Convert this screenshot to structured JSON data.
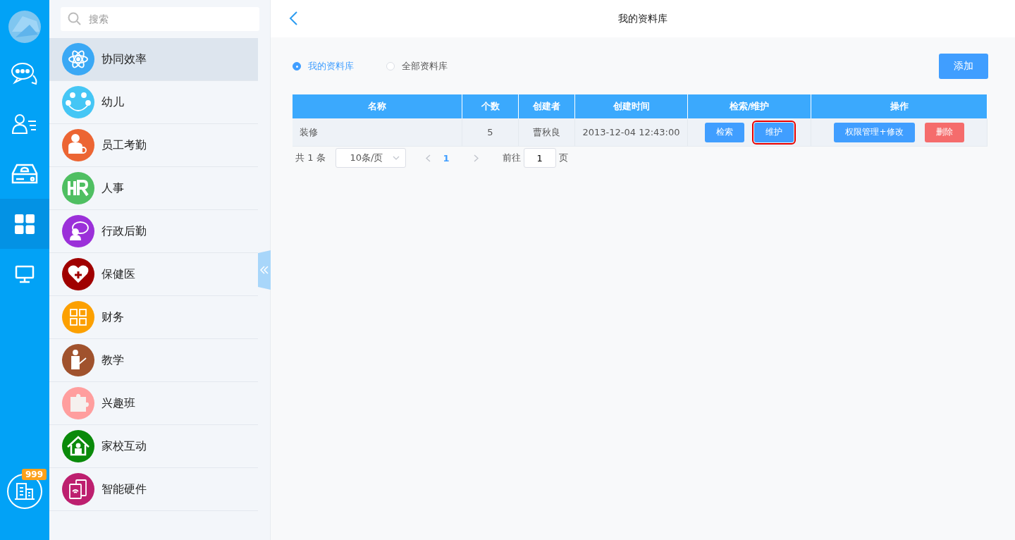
{
  "nav_rail": {
    "items": [
      {
        "selected": false
      },
      {
        "selected": false
      },
      {
        "selected": false
      },
      {
        "selected": true
      },
      {
        "selected": false
      }
    ],
    "badge": "999"
  },
  "sidebar": {
    "search": {
      "placeholder": "搜索"
    },
    "items": [
      {
        "label": "协同效率",
        "color": "#3aa8f5",
        "selected": true
      },
      {
        "label": "幼儿",
        "color": "#45c6f5",
        "selected": false
      },
      {
        "label": "员工考勤",
        "color": "#ec6533",
        "selected": false
      },
      {
        "label": "人事",
        "color": "#4fbf62",
        "selected": false
      },
      {
        "label": "行政后勤",
        "color": "#9b30d9",
        "selected": false
      },
      {
        "label": "保健医",
        "color": "#a00000",
        "selected": false
      },
      {
        "label": "财务",
        "color": "#fca000",
        "selected": false
      },
      {
        "label": "教学",
        "color": "#a0522d",
        "selected": false
      },
      {
        "label": "兴趣班",
        "color": "#ff9e9e",
        "selected": false
      },
      {
        "label": "家校互动",
        "color": "#0a8a0a",
        "selected": false
      },
      {
        "label": "智能硬件",
        "color": "#bd1f6f",
        "selected": false
      }
    ]
  },
  "header": {
    "title": "我的资料库"
  },
  "filters": [
    {
      "label": "我的资料库",
      "selected": true
    },
    {
      "label": "全部资料库",
      "selected": false
    }
  ],
  "add_button": "添加",
  "table": {
    "columns": [
      "名称",
      "个数",
      "创建者",
      "创建时间",
      "检索/维护",
      "操作"
    ],
    "rows": [
      {
        "name": "装修",
        "count": "5",
        "creator": "曹秋良",
        "created": "2013-12-04 12:43:00",
        "actions": [
          {
            "label": "检索",
            "kind": "primary",
            "highlighted": false
          },
          {
            "label": "维护",
            "kind": "primary",
            "highlighted": true
          }
        ],
        "operations": [
          {
            "label": "权限管理+修改",
            "kind": "primary",
            "highlighted": false
          },
          {
            "label": "删除",
            "kind": "danger",
            "highlighted": false
          }
        ]
      }
    ]
  },
  "pagination": {
    "total": "共 1 条",
    "page_size": "10条/页",
    "pages": [
      {
        "label": "1",
        "selected": true
      }
    ],
    "goto_label": "前往",
    "goto_value": "1",
    "page_suffix": "页"
  }
}
